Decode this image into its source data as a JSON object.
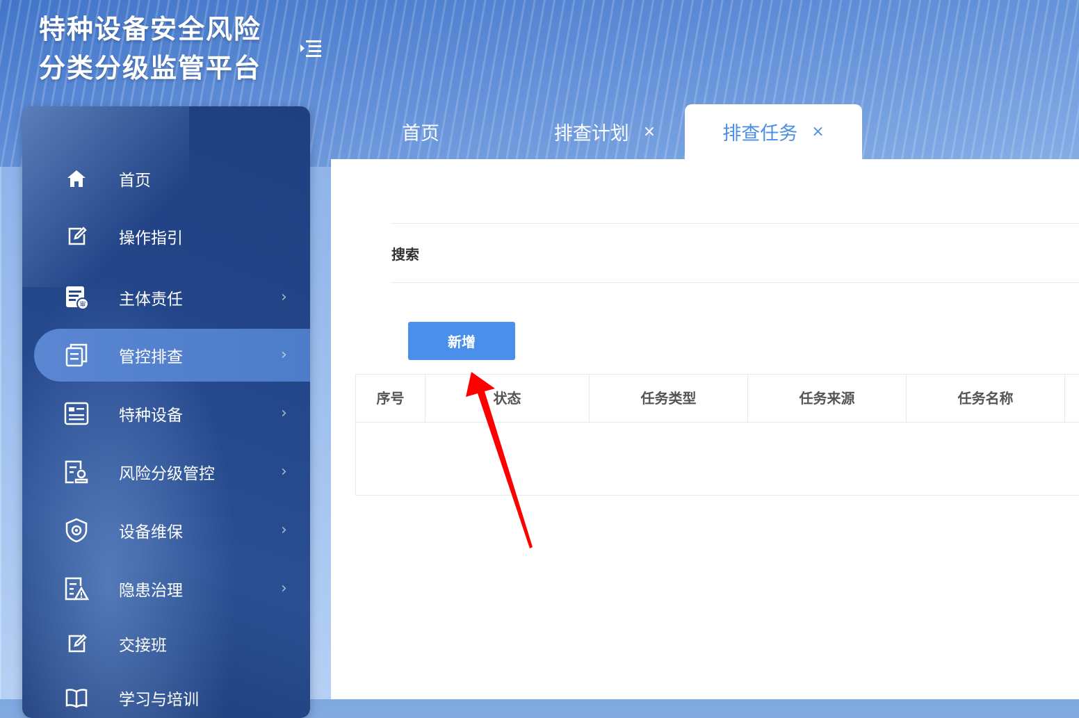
{
  "app": {
    "title_line1": "特种设备安全风险",
    "title_line2": "分类分级监管平台"
  },
  "sidebar": {
    "items": [
      {
        "label": "首页",
        "icon": "home-icon",
        "has_children": false
      },
      {
        "label": "操作指引",
        "icon": "edit-icon",
        "has_children": false
      },
      {
        "label": "主体责任",
        "icon": "audit-document-icon",
        "has_children": true
      },
      {
        "label": "管控排查",
        "icon": "document-copy-icon",
        "has_children": true,
        "active": true
      },
      {
        "label": "特种设备",
        "icon": "equipment-card-icon",
        "has_children": true
      },
      {
        "label": "风险分级管控",
        "icon": "document-user-icon",
        "has_children": true
      },
      {
        "label": "设备维保",
        "icon": "shield-gear-icon",
        "has_children": true
      },
      {
        "label": "隐患治理",
        "icon": "document-warning-icon",
        "has_children": true
      },
      {
        "label": "交接班",
        "icon": "edit-icon",
        "has_children": false
      },
      {
        "label": "学习与培训",
        "icon": "book-icon",
        "has_children": false
      }
    ]
  },
  "tabs": [
    {
      "label": "首页",
      "closable": false,
      "active": false
    },
    {
      "label": "排查计划",
      "closable": true,
      "active": false
    },
    {
      "label": "排查任务",
      "closable": true,
      "active": true
    }
  ],
  "tab_close_glyph": "×",
  "main": {
    "search_label": "搜索",
    "add_button": "新增",
    "table_headers": [
      "序号",
      "状态",
      "任务类型",
      "任务来源",
      "任务名称"
    ]
  },
  "colors": {
    "accent": "#4a90ea",
    "sidebar_bg": "#25488c",
    "sidebar_active": "#5a86d2",
    "annotation_arrow": "#ff0000"
  }
}
